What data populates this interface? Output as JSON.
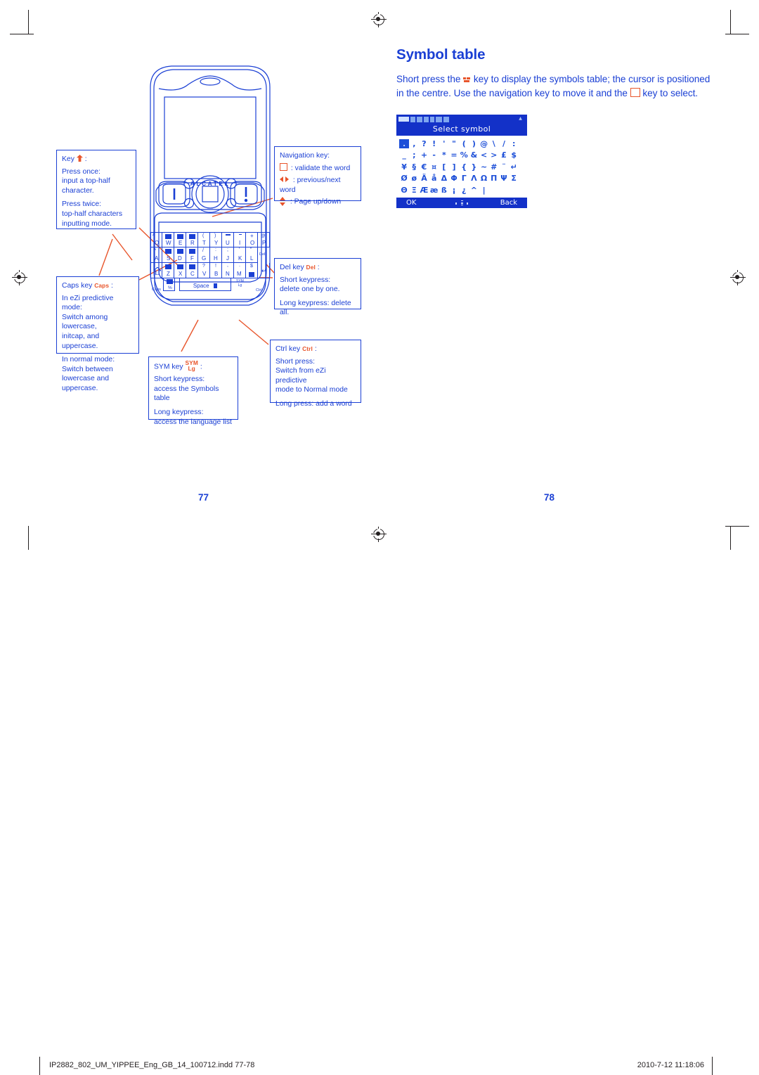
{
  "document": {
    "page_left": "77",
    "page_right": "78",
    "footer_filename": "IP2882_802_UM_YIPPEE_Eng_GB_14_100712.indd  77-78",
    "footer_timestamp": "2010-7-12   11:18:06"
  },
  "symbol_section": {
    "title": "Symbol table",
    "paragraph_part1": "Short press the",
    "paragraph_part2": "key to display the symbols table; the cursor is positioned in the centre. Use the navigation key to move it and the",
    "paragraph_part3": "key to select.",
    "sym_key_icon": "sym-key-icon",
    "ok_key_icon": "ok-square-key-icon"
  },
  "phone_screen": {
    "title": "Select symbol",
    "status_signal": "icon-signal",
    "softkey_left": "OK",
    "softkey_right": "Back",
    "nav_icon": "navigation-pad-icon",
    "selected_index": 0,
    "grid": [
      [
        ".",
        ",",
        "?",
        "!",
        "'",
        "\"",
        "(",
        ")",
        "@",
        "\\",
        "/",
        ":"
      ],
      [
        "_",
        ";",
        "+",
        "-",
        "*",
        "=",
        "%",
        "&",
        "<",
        ">",
        "£",
        "$"
      ],
      [
        "¥",
        "§",
        "€",
        "¤",
        "[",
        "]",
        "{",
        "}",
        "~",
        "#",
        "¨",
        "↵"
      ],
      [
        "Ø",
        "ø",
        "Ä",
        "å",
        "Δ",
        "Φ",
        "Γ",
        "Λ",
        "Ω",
        "Π",
        "Ψ",
        "Σ"
      ],
      [
        "Θ",
        "Ξ",
        "Æ",
        "æ",
        "ß",
        "¡",
        "¿",
        "^",
        "|"
      ]
    ]
  },
  "phone_illustration": {
    "brand": "ALCATEL",
    "spacebar_label": "Space",
    "caps_label": "Caps",
    "sym_label_top": "SYM",
    "sym_label_bottom": "Lg",
    "ctrl_label": "Ctrl",
    "del_label": "Del",
    "keyrows": [
      [
        {
          "top": "#",
          "main": "Q"
        },
        {
          "top": "1",
          "main": "W"
        },
        {
          "top": "2",
          "main": "E"
        },
        {
          "top": "3",
          "main": "R"
        },
        {
          "top": "(",
          "main": "T"
        },
        {
          "top": ")",
          "main": "Y"
        },
        {
          "top": "−",
          "main": "U"
        },
        {
          "top": "-",
          "main": "I"
        },
        {
          "top": "+",
          "main": "O"
        },
        {
          "top": "@",
          "main": "P"
        }
      ],
      [
        {
          "top": "*",
          "main": "A"
        },
        {
          "top": "4",
          "main": "S"
        },
        {
          "top": "5",
          "main": "D"
        },
        {
          "top": "6",
          "main": "F"
        },
        {
          "top": "/",
          "main": "G"
        },
        {
          "top": ":",
          "main": "H"
        },
        {
          "top": ";",
          "main": "J"
        },
        {
          "top": "'",
          "main": "K"
        },
        {
          "top": "\"",
          "main": "L"
        }
      ],
      [
        {
          "top": "7",
          "main": "Z"
        },
        {
          "top": "8",
          "main": "X"
        },
        {
          "top": "9",
          "main": "C"
        },
        {
          "top": "?",
          "main": "V"
        },
        {
          "top": "!",
          "main": "B"
        },
        {
          "top": ",",
          "main": "N"
        },
        {
          "top": ".",
          "main": "M"
        },
        {
          "top": "$",
          "main": ""
        }
      ]
    ]
  },
  "callouts": {
    "shift": {
      "header_pre": "Key",
      "header_post": ":",
      "icon": "shift-arrow-icon",
      "lines": [
        "Press once:",
        "input a top-half",
        "character."
      ],
      "lines2": [
        "Press twice:",
        "top-half characters",
        "inputting mode."
      ]
    },
    "caps": {
      "header_pre": "Caps key",
      "badge": "Caps",
      "header_post": ":",
      "lines": [
        "In eZi predictive mode:",
        "Switch among lowercase,",
        "initcap, and uppercase."
      ],
      "lines2": [
        "In normal mode:",
        "Switch between",
        "lowercase and uppercase."
      ]
    },
    "sym": {
      "header_pre": "SYM key",
      "badge_top": "SYM",
      "badge_bottom": "Lg",
      "header_post": ":",
      "lines": [
        "Short keypress:",
        "access the Symbols table"
      ],
      "lines2": [
        "Long keypress:",
        "access the language list"
      ]
    },
    "navigation": {
      "header": "Navigation key:",
      "items": [
        {
          "icon": "square-key-icon",
          "text": ": validate the word"
        },
        {
          "icon": "left-right-arrows-icon",
          "text": ": previous/next word"
        },
        {
          "icon": "up-down-arrows-icon",
          "text": ": Page up/down"
        }
      ]
    },
    "del": {
      "header_pre": "Del key",
      "badge": "Del",
      "header_post": ":",
      "lines": [
        "Short keypress:",
        "delete one by one."
      ],
      "lines2": [
        "Long keypress: delete all."
      ]
    },
    "ctrl": {
      "header_pre": "Ctrl key",
      "badge": "Ctrl",
      "header_post": ":",
      "lines": [
        "Short press:",
        "Switch from eZi predictive",
        "mode to Normal mode"
      ],
      "lines2": [
        "Long press: add a word"
      ]
    }
  },
  "colors": {
    "blue": "#1a3fd4",
    "orange": "#e8552b",
    "screen_blue": "#1331c8",
    "black": "#231f20"
  }
}
